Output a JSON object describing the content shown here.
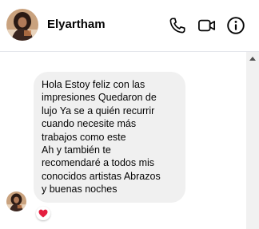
{
  "header": {
    "contact_name": "Elyartham",
    "avatar_icon": "profile-photo",
    "actions": [
      {
        "icon": "phone-icon"
      },
      {
        "icon": "video-camera-icon"
      },
      {
        "icon": "info-icon"
      }
    ]
  },
  "conversation": {
    "message_text": "Hola Estoy feliz con las\nimpresiones Quedaron de\nlujo Ya se a quién recurrir\ncuando necesite más\ntrabajos como este\nAh y también te\nrecomendaré a todos mis\nconocidos artistas Abrazos\ny buenas noches",
    "reaction_icon": "heart-icon",
    "bubble_color": "#f0f0f0",
    "reaction_color": "#e41e3f"
  }
}
